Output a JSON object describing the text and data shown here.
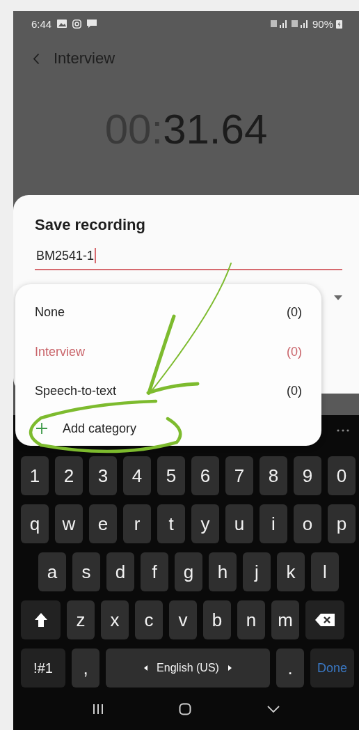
{
  "status_bar": {
    "time": "6:44",
    "battery": "90%"
  },
  "header": {
    "title": "Interview"
  },
  "timer": {
    "faded": "00:",
    "value": "31.64"
  },
  "dialog": {
    "title": "Save recording",
    "name_value": "BM2541-1"
  },
  "category_menu": {
    "items": [
      {
        "label": "None",
        "count": "(0)",
        "selected": false
      },
      {
        "label": "Interview",
        "count": "(0)",
        "selected": true
      },
      {
        "label": "Speech-to-text",
        "count": "(0)",
        "selected": false
      }
    ],
    "add_label": "Add category"
  },
  "keyboard": {
    "rows": [
      {
        "keys": [
          {
            "kind": "char",
            "label": "1"
          },
          {
            "kind": "char",
            "label": "2"
          },
          {
            "kind": "char",
            "label": "3"
          },
          {
            "kind": "char",
            "label": "4"
          },
          {
            "kind": "char",
            "label": "5"
          },
          {
            "kind": "char",
            "label": "6"
          },
          {
            "kind": "char",
            "label": "7"
          },
          {
            "kind": "char",
            "label": "8"
          },
          {
            "kind": "char",
            "label": "9"
          },
          {
            "kind": "char",
            "label": "0"
          }
        ]
      },
      {
        "keys": [
          {
            "kind": "char",
            "label": "q"
          },
          {
            "kind": "char",
            "label": "w"
          },
          {
            "kind": "char",
            "label": "e"
          },
          {
            "kind": "char",
            "label": "r"
          },
          {
            "kind": "char",
            "label": "t"
          },
          {
            "kind": "char",
            "label": "y"
          },
          {
            "kind": "char",
            "label": "u"
          },
          {
            "kind": "char",
            "label": "i"
          },
          {
            "kind": "char",
            "label": "o"
          },
          {
            "kind": "char",
            "label": "p"
          }
        ]
      },
      {
        "keys": [
          {
            "kind": "char",
            "label": "a"
          },
          {
            "kind": "char",
            "label": "s"
          },
          {
            "kind": "char",
            "label": "d"
          },
          {
            "kind": "char",
            "label": "f"
          },
          {
            "kind": "char",
            "label": "g"
          },
          {
            "kind": "char",
            "label": "h"
          },
          {
            "kind": "char",
            "label": "j"
          },
          {
            "kind": "char",
            "label": "k"
          },
          {
            "kind": "char",
            "label": "l"
          }
        ]
      },
      {
        "keys": [
          {
            "kind": "shift"
          },
          {
            "kind": "char",
            "label": "z"
          },
          {
            "kind": "char",
            "label": "x"
          },
          {
            "kind": "char",
            "label": "c"
          },
          {
            "kind": "char",
            "label": "v"
          },
          {
            "kind": "char",
            "label": "b"
          },
          {
            "kind": "char",
            "label": "n"
          },
          {
            "kind": "char",
            "label": "m"
          },
          {
            "kind": "backspace"
          }
        ]
      },
      {
        "keys": [
          {
            "kind": "symbols",
            "label": "!#1"
          },
          {
            "kind": "char",
            "label": ","
          },
          {
            "kind": "space",
            "label": "English (US)"
          },
          {
            "kind": "char",
            "label": "."
          },
          {
            "kind": "done",
            "label": "Done"
          }
        ]
      }
    ]
  }
}
